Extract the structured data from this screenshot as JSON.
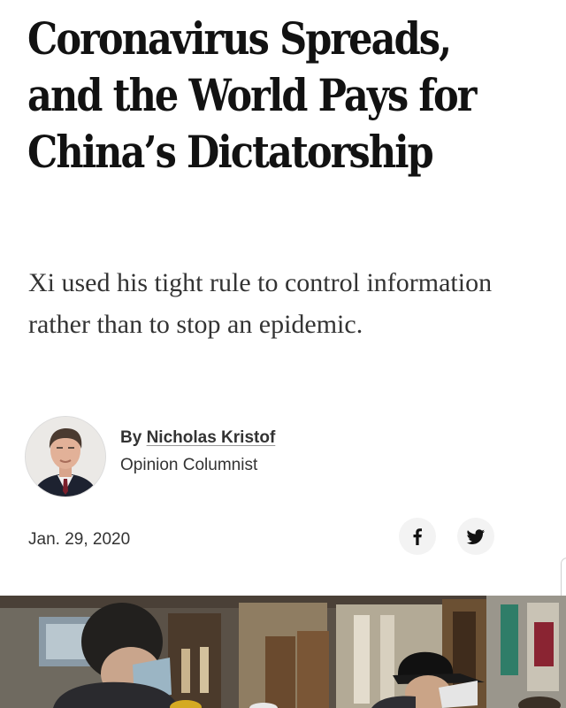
{
  "article": {
    "headline_lines": [
      "Coronavirus Spreads,",
      "and the World Pays for",
      "China’s Dictatorship"
    ],
    "summary": "Xi used his tight rule to control information rather than to stop an epidemic.",
    "byline": {
      "prefix": "By",
      "author": "Nicholas Kristof",
      "role": "Opinion Columnist"
    },
    "date": "Jan. 29, 2020"
  },
  "share": {
    "facebook_icon": "facebook-icon",
    "twitter_icon": "twitter-icon"
  },
  "colors": {
    "text": "#121212",
    "secondary_text": "#333333",
    "share_bg": "#f3f3f3"
  }
}
